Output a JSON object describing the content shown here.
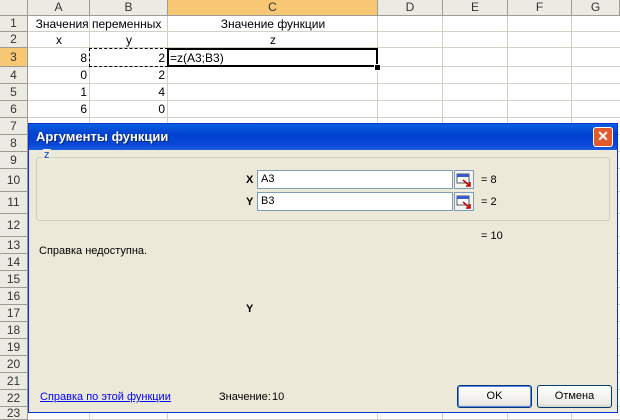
{
  "columns": [
    "A",
    "B",
    "C",
    "D",
    "E",
    "F",
    "G"
  ],
  "rows": [
    "1",
    "2",
    "3",
    "4",
    "5",
    "6",
    "7",
    "8",
    "9",
    "10",
    "11",
    "12",
    "13",
    "14",
    "15",
    "16",
    "17",
    "18",
    "19",
    "20",
    "21",
    "22",
    "23"
  ],
  "cells": {
    "A1": "Значения переменных",
    "C1": "Значение функции",
    "A2": "x",
    "B2": "y",
    "C2": "z",
    "A3": "8",
    "B3": "2",
    "C3": "=z(A3;B3)",
    "A4": "0",
    "B4": "2",
    "A5": "1",
    "B5": "4",
    "A6": "6",
    "B6": "0"
  },
  "dialog": {
    "title": "Аргументы функции",
    "close_glyph": "✕",
    "group_label": "z",
    "args": [
      {
        "label": "X",
        "value": "A3",
        "result": "= 8"
      },
      {
        "label": "Y",
        "value": "B3",
        "result": "= 2"
      }
    ],
    "formula_result": "= 10",
    "help_unavailable": "Справка недоступна.",
    "arg_description_label": "Y",
    "help_link": "Справка по этой функции",
    "value_label": "Значение:",
    "value": "10",
    "ok_label": "OK",
    "cancel_label": "Отмена"
  },
  "colors": {
    "selected_header": "#f7c774",
    "title_bar": "#0a5fe0",
    "link": "#0000ff",
    "group_label": "#0046d5"
  }
}
